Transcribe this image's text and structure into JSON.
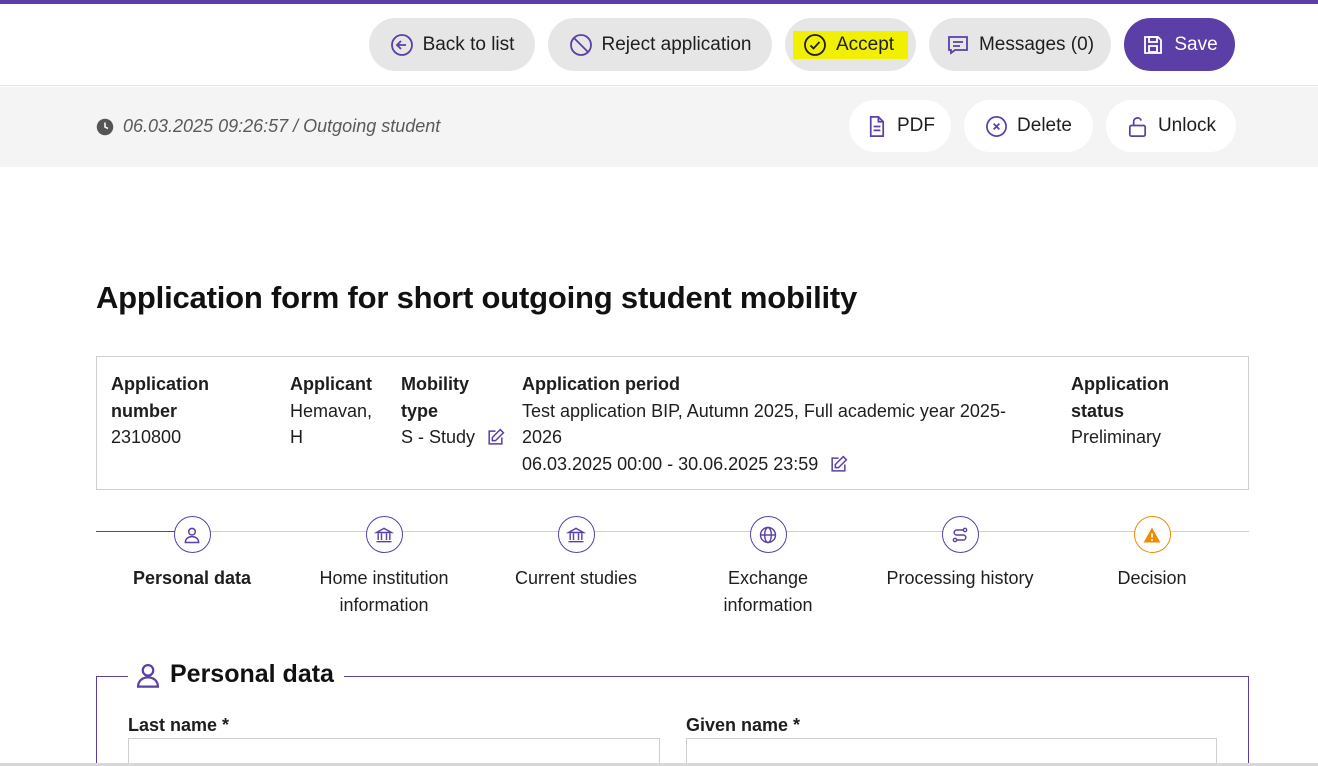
{
  "toolbar": {
    "back_label": "Back to list",
    "reject_label": "Reject application",
    "accept_label": "Accept",
    "messages_label": "Messages (0)",
    "save_label": "Save"
  },
  "subbar": {
    "meta": "06.03.2025 09:26:57 / Outgoing student",
    "pdf_label": "PDF",
    "delete_label": "Delete",
    "unlock_label": "Unlock"
  },
  "title": "Application form for short outgoing student mobility",
  "summary": {
    "app_number": {
      "label_line1": "Application",
      "label_line2": "number",
      "value": "2310800"
    },
    "applicant": {
      "label": "Applicant",
      "value_line1": "Hemavan,",
      "value_line2": "H"
    },
    "mobility": {
      "label_line1": "Mobility",
      "label_line2": "type",
      "value": "S - Study"
    },
    "period": {
      "label": "Application period",
      "value_line1": "Test application BIP, Autumn 2025, Full academic year 2025-",
      "value_line2": "2026",
      "value_line3": "06.03.2025 00:00 - 30.06.2025 23:59"
    },
    "status": {
      "label_line1": "Application",
      "label_line2": "status",
      "value": "Preliminary"
    }
  },
  "steps": [
    {
      "line1": "Personal data",
      "line2": "",
      "icon": "user-icon"
    },
    {
      "line1": "Home institution",
      "line2": "information",
      "icon": "institution-icon"
    },
    {
      "line1": "Current studies",
      "line2": "",
      "icon": "institution-icon"
    },
    {
      "line1": "Exchange",
      "line2": "information",
      "icon": "globe-icon"
    },
    {
      "line1": "Processing history",
      "line2": "",
      "icon": "route-icon"
    },
    {
      "line1": "Decision",
      "line2": "",
      "icon": "warning-icon"
    }
  ],
  "personal": {
    "legend": "Personal data",
    "last_name_label": "Last name *",
    "last_name_value": "",
    "given_name_label": "Given name *",
    "given_name_value": ""
  },
  "colors": {
    "accent": "#5b3fa6",
    "warning": "#f08a00",
    "highlight": "#f0f000"
  }
}
